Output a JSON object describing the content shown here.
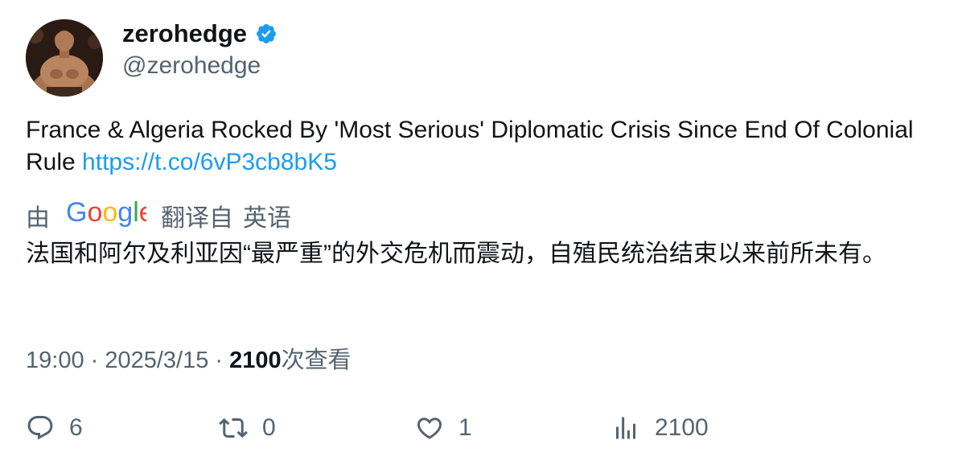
{
  "author": {
    "display_name": "zerohedge",
    "handle": "@zerohedge",
    "verified": true,
    "verified_color": "#1d9bf0"
  },
  "tweet": {
    "text": "France & Algeria Rocked By 'Most Serious' Diplomatic Crisis Since End Of Colonial Rule ",
    "link": "https://t.co/6vP3cb8bK5",
    "link_color": "#1d9bf0"
  },
  "translation": {
    "by_label": "由",
    "provider": "Google",
    "translated_from_label": "翻译自",
    "source_language": "英语",
    "text": "法国和阿尔及利亚因“最严重”的外交危机而震动，自殖民统治结束以来前所未有。"
  },
  "meta": {
    "time": "19:00",
    "separator": " · ",
    "date": "2025/3/15",
    "views_count": "2100",
    "views_label": "次查看"
  },
  "actions": {
    "reply_count": "6",
    "retweet_count": "0",
    "like_count": "1",
    "views_count": "2100",
    "icons": [
      "reply-icon",
      "retweet-icon",
      "like-icon",
      "views-icon"
    ]
  }
}
